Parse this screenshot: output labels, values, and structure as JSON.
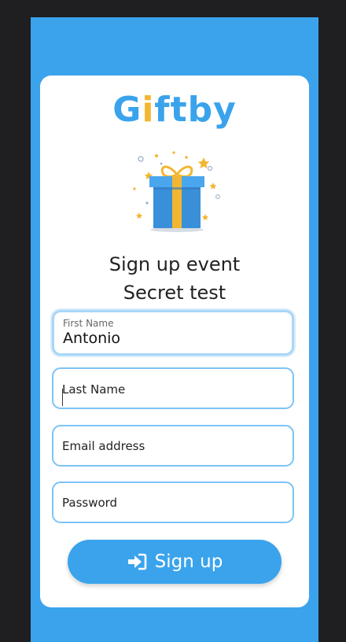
{
  "app": {
    "logo_text": "Giftby",
    "colors": {
      "primary": "#3aa3ec",
      "accent": "#f2b632",
      "background": "#1f1f22",
      "card": "#ffffff"
    }
  },
  "hero": {
    "icon": "gift-icon",
    "title_line1": "Sign up event",
    "title_line2": "Secret test"
  },
  "form": {
    "first_name": {
      "label": "First Name",
      "value": "Antonio"
    },
    "last_name": {
      "placeholder": "Last Name"
    },
    "email": {
      "placeholder": "Email address"
    },
    "password": {
      "placeholder": "Password"
    },
    "submit": {
      "label": "Sign up",
      "icon": "sign-in-icon"
    }
  }
}
